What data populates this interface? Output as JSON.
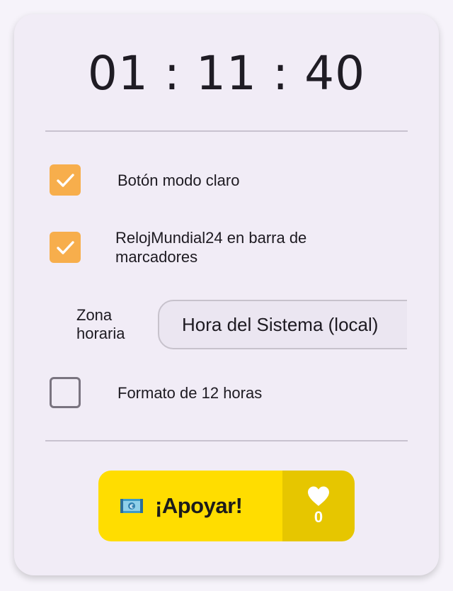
{
  "clock": {
    "time": "01 : 11 : 40"
  },
  "options": {
    "light_mode": {
      "label": "Botón modo claro",
      "checked": true
    },
    "bookmarks_bar": {
      "label": "RelojMundial24 en barra de marcadores",
      "checked": true
    },
    "twelve_hour": {
      "label": "Formato de 12 horas",
      "checked": false
    }
  },
  "timezone": {
    "label": "Zona horaria",
    "selected": "Hora del Sistema (local)"
  },
  "support": {
    "label": "¡Apoyar!",
    "icon": "money-icon",
    "likes": "0"
  },
  "colors": {
    "checkbox_checked": "#f7ae4c",
    "support_button": "#ffdd00",
    "support_likes_bg": "#e6c600",
    "panel_bg": "#f1ecf6"
  }
}
